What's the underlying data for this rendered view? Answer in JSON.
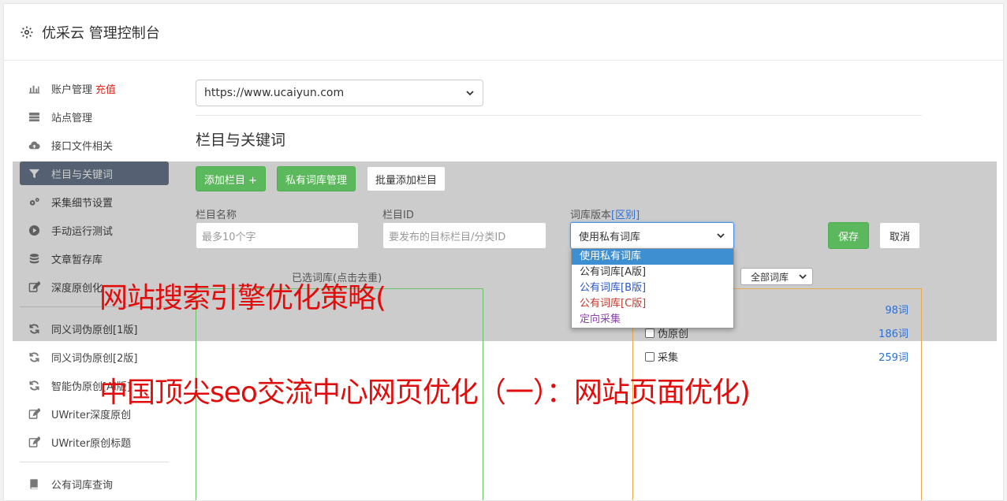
{
  "header": {
    "title": "优采云 管理控制台"
  },
  "sidebar": {
    "items": [
      {
        "label": "账户管理",
        "badge": "充值",
        "icon": "bar-chart-icon"
      },
      {
        "label": "站点管理",
        "icon": "server-icon"
      },
      {
        "label": "接口文件相关",
        "icon": "cloud-upload-icon"
      },
      {
        "label": "栏目与关键词",
        "icon": "filter-icon",
        "active": true
      },
      {
        "label": "采集细节设置",
        "icon": "gears-icon"
      },
      {
        "label": "手动运行测试",
        "icon": "play-circle-icon"
      },
      {
        "label": "文章暂存库",
        "icon": "database-icon"
      },
      {
        "label": "深度原创化",
        "icon": "edit-icon"
      },
      {
        "label": "同义词伪原创[1版]",
        "icon": "refresh-icon"
      },
      {
        "label": "同义词伪原创[2版]",
        "icon": "refresh-icon"
      },
      {
        "label": "智能伪原创[AI版]",
        "icon": "refresh-icon"
      },
      {
        "label": "UWriter深度原创",
        "icon": "edit-icon"
      },
      {
        "label": "UWriter原创标题",
        "icon": "edit-icon"
      },
      {
        "label": "公有词库查询",
        "icon": "book-icon"
      }
    ]
  },
  "main": {
    "site_select": "https://www.ucaiyun.com",
    "section_title": "栏目与关键词",
    "buttons": {
      "add_column": "添加栏目 +",
      "private_lib": "私有词库管理",
      "batch_add": "批量添加栏目"
    },
    "form": {
      "name_label": "栏目名称",
      "name_placeholder": "最多10个字",
      "id_label": "栏目ID",
      "id_placeholder": "要发布的目标栏目/分类ID",
      "version_label": "词库版本",
      "version_link": "[区别]",
      "version_value": "使用私有词库",
      "save": "保存",
      "cancel": "取消"
    },
    "dropdown": [
      {
        "label": "使用私有词库",
        "color": "#ffffff"
      },
      {
        "label": "公有词库[A版]",
        "color": "#333333"
      },
      {
        "label": "公有词库[B版]",
        "color": "#2a56c6"
      },
      {
        "label": "公有词库[C版]",
        "color": "#c0392b"
      },
      {
        "label": "定向采集",
        "color": "#8e44ad"
      }
    ],
    "left_panel_title": "已选词库(点击去重)",
    "right_filter": "全部词库",
    "right_rows": [
      {
        "label": "",
        "count": "98词"
      },
      {
        "label": "伪原创",
        "count": "186词"
      },
      {
        "label": "采集",
        "count": "259词"
      }
    ]
  },
  "overlay_text": {
    "line1": "网站搜索引擎优化策略(",
    "line2": "中国顶尖seo交流中心网页优化（一）：网站页面优化)"
  }
}
